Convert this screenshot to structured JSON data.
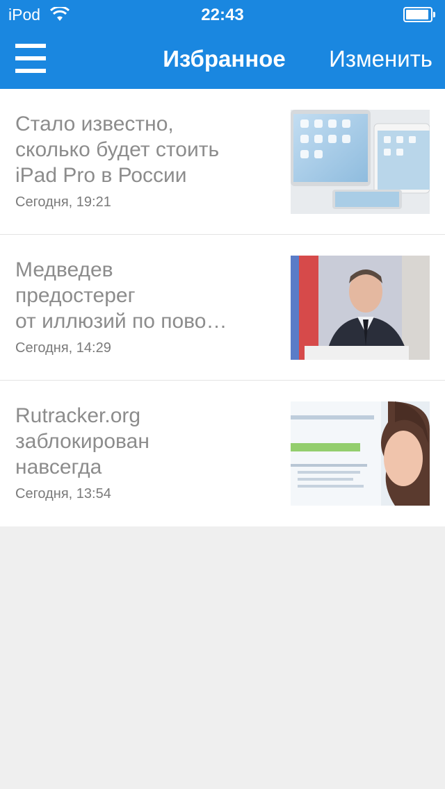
{
  "status_bar": {
    "carrier": "iPod",
    "time": "22:43",
    "wifi_icon": "wifi-icon",
    "battery_icon": "battery-icon"
  },
  "nav": {
    "menu_icon": "hamburger-menu-icon",
    "title": "Избранное",
    "edit_label": "Изменить"
  },
  "colors": {
    "header": "#1a87e0",
    "background": "#efefef",
    "title_text": "#8c8c8c"
  },
  "articles": [
    {
      "title": "Стало известно,\nсколько будет стоить\niPad Pro в России",
      "date": "Сегодня, 19:21",
      "thumbnail": "ipad-devices-image"
    },
    {
      "title": "Медведев\nпредостерег\nот иллюзий по пово…",
      "date": "Сегодня, 14:29",
      "thumbnail": "medvedev-portrait-image"
    },
    {
      "title": "Rutracker.org\nзаблокирован\nнавсегда",
      "date": "Сегодня, 13:54",
      "thumbnail": "woman-at-monitor-image"
    }
  ]
}
